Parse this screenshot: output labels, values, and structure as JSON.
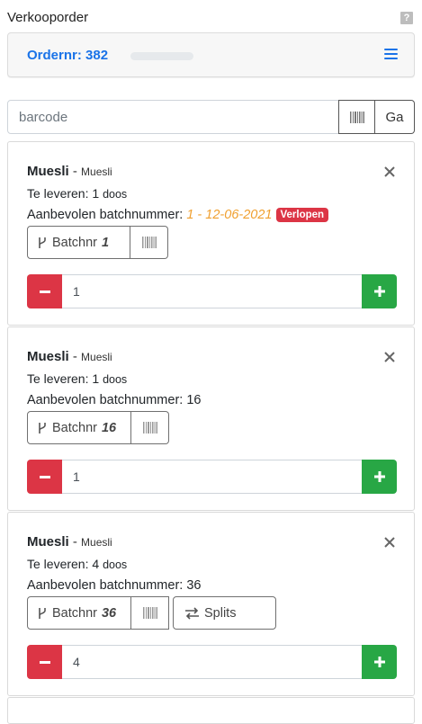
{
  "page": {
    "title": "Verkooporder",
    "help_label": "?"
  },
  "order": {
    "label": "Ordernr: 382"
  },
  "search": {
    "placeholder": "barcode",
    "go_label": "Ga"
  },
  "items": [
    {
      "product": "Muesli",
      "separator": "-",
      "product_sub": "Muesli",
      "deliver_label": "Te leveren:",
      "deliver_qty": "1",
      "deliver_unit": "doos",
      "batch_label": "Aanbevolen batchnummer:",
      "batch_value": "1 - 12-06-2021",
      "badge": "Verlopen",
      "batch_button_label": "Batchnr",
      "batch_button_num": "1",
      "quantity": "1"
    },
    {
      "product": "Muesli",
      "separator": "-",
      "product_sub": "Muesli",
      "deliver_label": "Te leveren:",
      "deliver_qty": "1",
      "deliver_unit": "doos",
      "batch_label": "Aanbevolen batchnummer:",
      "batch_value": "16",
      "batch_button_label": "Batchnr",
      "batch_button_num": "16",
      "quantity": "1"
    },
    {
      "product": "Muesli",
      "separator": "-",
      "product_sub": "Muesli",
      "deliver_label": "Te leveren:",
      "deliver_qty": "4",
      "deliver_unit": "doos",
      "batch_label": "Aanbevolen batchnummer:",
      "batch_value": "36",
      "batch_button_label": "Batchnr",
      "batch_button_num": "36",
      "splits_label": "Splits",
      "quantity": "4"
    }
  ],
  "colors": {
    "accent": "#1a73e8",
    "danger": "#dc3545",
    "success": "#28a745",
    "warning_text": "#f0a030"
  }
}
